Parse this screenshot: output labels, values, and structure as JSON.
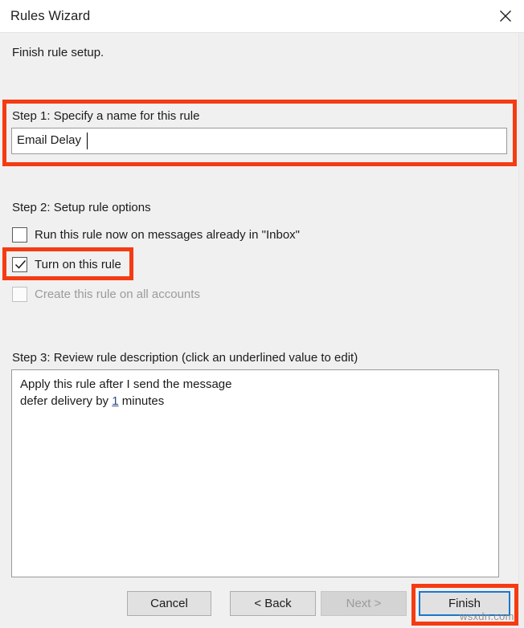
{
  "window": {
    "title": "Rules Wizard",
    "close_icon": "close-icon",
    "subtitle": "Finish rule setup."
  },
  "step1": {
    "label": "Step 1: Specify a name for this rule",
    "name_value": "Email Delay",
    "name_placeholder": ""
  },
  "step2": {
    "label": "Step 2: Setup rule options",
    "options": [
      {
        "label": "Run this rule now on messages already in \"Inbox\"",
        "checked": false,
        "disabled": false
      },
      {
        "label": "Turn on this rule",
        "checked": true,
        "disabled": false
      },
      {
        "label": "Create this rule on all accounts",
        "checked": false,
        "disabled": true
      }
    ]
  },
  "step3": {
    "label": "Step 3: Review rule description (click an underlined value to edit)",
    "description_lines": [
      {
        "prefix": "Apply this rule after I send the message",
        "link": "",
        "suffix": ""
      },
      {
        "prefix": "defer delivery by ",
        "link": "1",
        "suffix": " minutes"
      }
    ]
  },
  "footer": {
    "cancel_label": "Cancel",
    "back_label": "< Back",
    "next_label": "Next >",
    "finish_label": "Finish"
  },
  "annotations": {
    "highlight_color": "#f53b12",
    "focus_color": "#1b77c9",
    "watermark": "wsxdn.com"
  }
}
